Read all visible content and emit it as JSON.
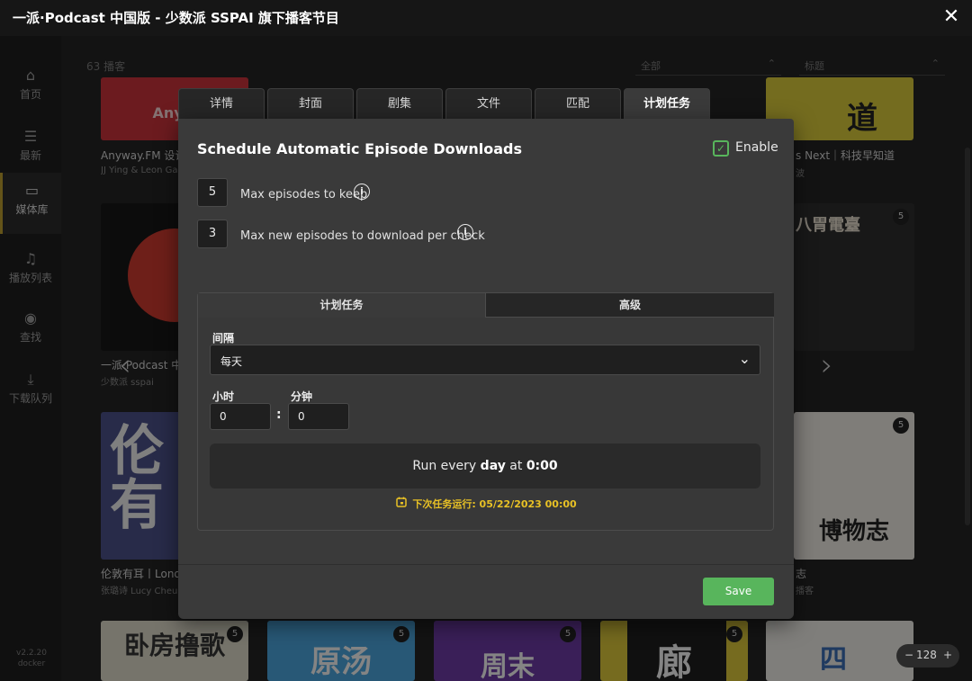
{
  "window": {
    "title": "一派·Podcast 中国版 - 少数派 SSPAI 旗下播客节目",
    "close_glyph": "✕"
  },
  "sidebar": {
    "items": [
      {
        "icon": "home-icon",
        "glyph": "⌂",
        "label": "首页"
      },
      {
        "icon": "list-icon",
        "glyph": "☰",
        "label": "最新"
      },
      {
        "icon": "book-icon",
        "glyph": "▭",
        "label": "媒体库"
      },
      {
        "icon": "playlist-icon",
        "glyph": "♫",
        "label": "播放列表"
      },
      {
        "icon": "broadcast-icon",
        "glyph": "◉",
        "label": "查找"
      },
      {
        "icon": "download-icon",
        "glyph": "⤓",
        "label": "下载队列"
      }
    ],
    "version": "v2.2.20",
    "platform": "docker"
  },
  "library": {
    "count_label": "63 播客",
    "filter_value": "全部",
    "sort_value": "标题",
    "cards": [
      {
        "title": "Anyway.FM 设计",
        "author": "JJ Ying & Leon Gao",
        "cover_text": "Anyw",
        "badge": ""
      },
      {
        "title": "一派·Podcast 中",
        "author": "少数派 sspai",
        "cover_text": "",
        "badge": ""
      },
      {
        "title": "伦敦有耳丨Lond",
        "author": "张璐诗 Lucy Cheung",
        "cover_text": "伦有",
        "badge": ""
      },
      {
        "title": "s Next｜科技早知道",
        "author": "波",
        "cover_text": "道",
        "badge": ""
      },
      {
        "title": "",
        "author": "",
        "cover_text": "八胃電臺",
        "badge": "5"
      },
      {
        "title": "志",
        "author": "播客",
        "cover_text": "博物志",
        "badge": "5"
      }
    ],
    "bottom_row": [
      {
        "cover_text": "卧房撸歌",
        "badge": "5"
      },
      {
        "cover_text": "原汤",
        "badge": "5"
      },
      {
        "cover_text": "周末",
        "badge": "5"
      },
      {
        "cover_text": "廊",
        "badge": "5"
      },
      {
        "cover_text": "四",
        "badge": ""
      }
    ],
    "prev_glyph": "‹",
    "next_glyph": "›",
    "zoom": {
      "minus": "−",
      "value": "128",
      "plus": "+"
    }
  },
  "modal": {
    "tabs": [
      "详情",
      "封面",
      "剧集",
      "文件",
      "匹配",
      "计划任务"
    ],
    "active_tab": 5,
    "heading": "Schedule Automatic Episode Downloads",
    "enable": {
      "label": "Enable",
      "checked": true,
      "glyph": "✓"
    },
    "max_keep": {
      "value": "5",
      "label": "Max episodes to keep",
      "info": "i"
    },
    "max_new": {
      "value": "3",
      "label": "Max new episodes to download per check",
      "info": "i"
    },
    "inner_tabs": [
      "计划任务",
      "高级"
    ],
    "interval": {
      "label": "间隔",
      "value": "每天",
      "chevron": "⌄"
    },
    "hour": {
      "label": "小时",
      "value": "0"
    },
    "minute": {
      "label": "分钟",
      "value": "0"
    },
    "colon": ":",
    "summary": {
      "prefix": "Run every ",
      "unit": "day",
      "middle": " at ",
      "time": "0:00"
    },
    "next_run": "下次任务运行: 05/22/2023 00:00",
    "save_label": "Save"
  },
  "colors": {
    "accent_green": "#58b55c",
    "next_run_yellow": "#e8c125",
    "panel_bg": "#3a3a3a"
  }
}
